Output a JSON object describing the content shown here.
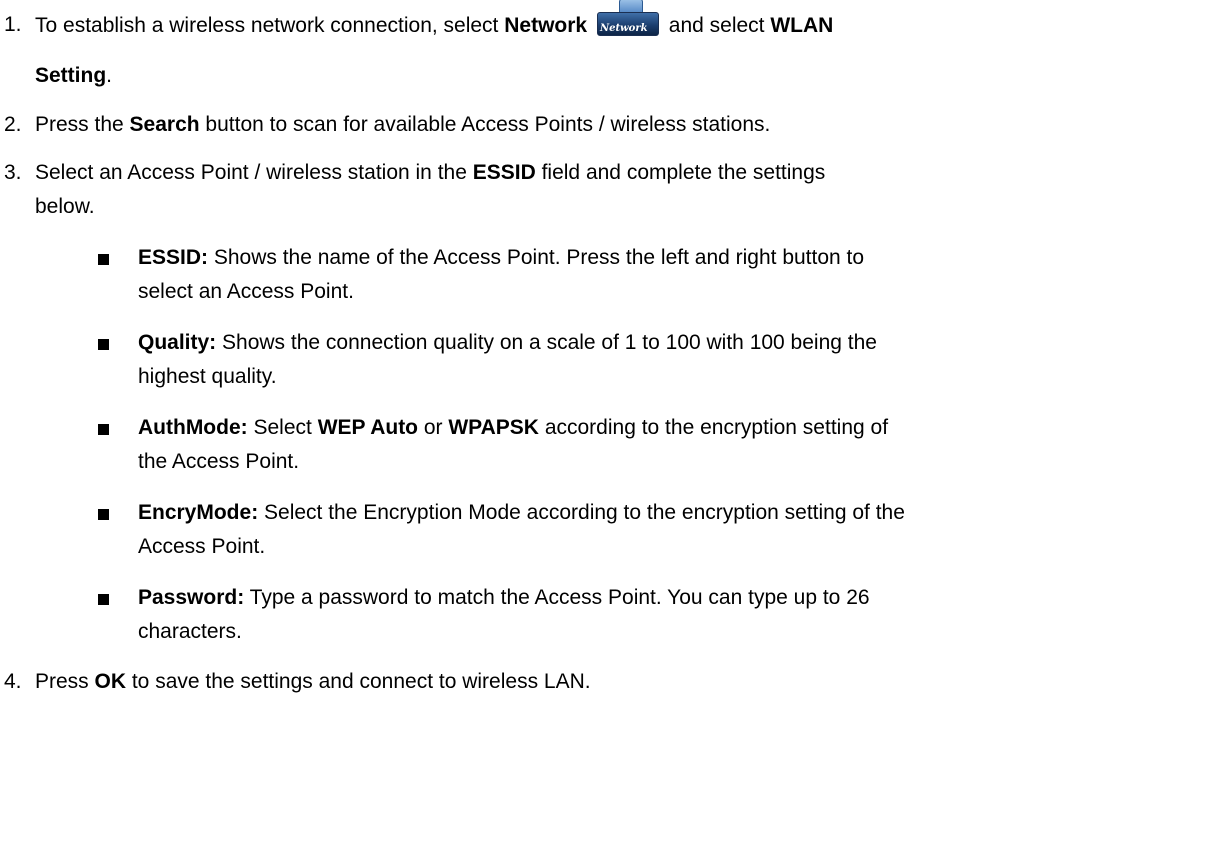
{
  "steps": [
    {
      "number": "1.",
      "line1_prefix": "To establish a wireless network connection, select ",
      "bold_network": "Network",
      "icon_label": "Network",
      "line1_mid": " and select ",
      "bold_wlan": "WLAN",
      "line2_bold": "Setting",
      "line2_suffix": "."
    },
    {
      "number": "2.",
      "prefix": "Press the ",
      "bold": "Search",
      "suffix": " button to scan for available Access Points / wireless stations."
    },
    {
      "number": "3.",
      "prefix": "Select an Access Point / wireless station in the ",
      "bold": "ESSID",
      "suffix": " field and complete the settings",
      "line2": "below."
    },
    {
      "number": "4.",
      "prefix": "Press ",
      "bold": "OK",
      "suffix": " to save the settings and connect to wireless LAN."
    }
  ],
  "bullets": {
    "essid": {
      "term": "ESSID:",
      "line1": " Shows the name of the Access Point. Press the left and right button to",
      "line2": "select an Access Point."
    },
    "quality": {
      "term": "Quality:",
      "line1": " Shows the connection quality on a scale of 1 to 100 with 100 being the",
      "line2": "highest quality."
    },
    "authmode": {
      "term": "AuthMode:",
      "line1_a": " Select ",
      "bold1": "WEP Auto",
      "line1_b": " or ",
      "bold2": "WPAPSK",
      "line1_c": " according to the encryption setting of",
      "line2": "the Access Point."
    },
    "encrymode": {
      "term": "EncryMode:",
      "line1": " Select the Encryption Mode according to the encryption setting of the",
      "line2": "Access Point."
    },
    "password": {
      "term": "Password:",
      "line1": " Type a password to match the Access Point. You can type up to 26",
      "line2": "characters."
    }
  }
}
